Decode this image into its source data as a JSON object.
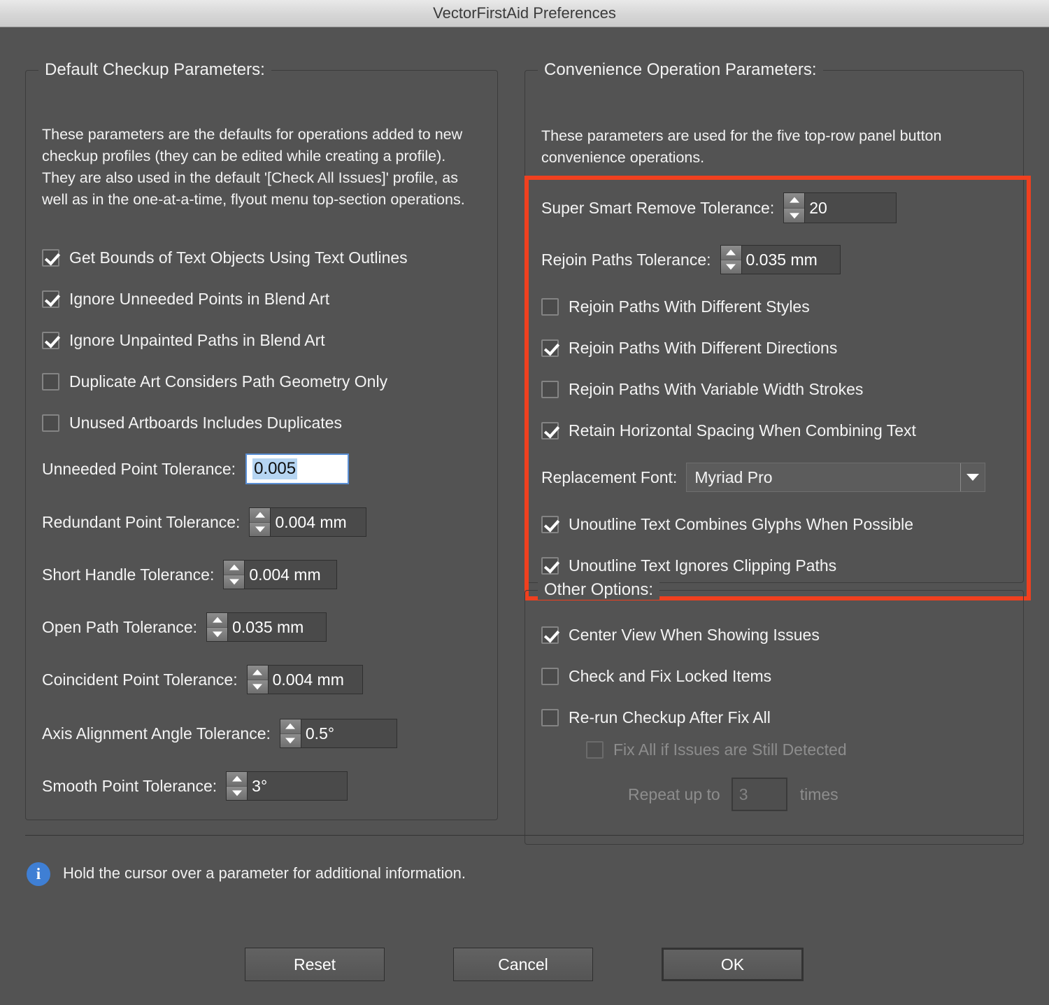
{
  "window": {
    "title": "VectorFirstAid Preferences"
  },
  "default_checkup": {
    "legend": "Default Checkup Parameters:",
    "description": "These parameters are the defaults for operations added to new checkup profiles (they can be edited while creating a profile). They are also used in the default '[Check All Issues]' profile, as well as in the one-at-a-time, flyout menu top-section operations.",
    "checkboxes": [
      {
        "label": "Get Bounds of Text Objects Using Text Outlines",
        "checked": true
      },
      {
        "label": "Ignore Unneeded Points in Blend Art",
        "checked": true
      },
      {
        "label": "Ignore Unpainted Paths in Blend Art",
        "checked": true
      },
      {
        "label": "Duplicate Art Considers Path Geometry Only",
        "checked": false
      },
      {
        "label": "Unused Artboards Includes Duplicates",
        "checked": false
      }
    ],
    "unneeded_point": {
      "label": "Unneeded Point Tolerance:",
      "value": "0.005",
      "selected": true
    },
    "fields": [
      {
        "label": "Redundant Point Tolerance:",
        "value": "0.004 mm"
      },
      {
        "label": "Short Handle Tolerance:",
        "value": "0.004 mm"
      },
      {
        "label": "Open Path Tolerance:",
        "value": "0.035 mm"
      },
      {
        "label": "Coincident Point Tolerance:",
        "value": "0.004 mm"
      },
      {
        "label": "Axis Alignment Angle Tolerance:",
        "value": "0.5°"
      },
      {
        "label": "Smooth Point Tolerance:",
        "value": "3°"
      }
    ]
  },
  "convenience": {
    "legend": "Convenience Operation Parameters:",
    "description": "These parameters are used for the five top-row panel button convenience operations.",
    "highlight_color": "#f0401f",
    "super_smart_remove": {
      "label": "Super Smart Remove Tolerance:",
      "value": "20"
    },
    "rejoin_paths_tolerance": {
      "label": "Rejoin Paths Tolerance:",
      "value": "0.035 mm"
    },
    "checkboxes": [
      {
        "label": "Rejoin Paths With Different Styles",
        "checked": false
      },
      {
        "label": "Rejoin Paths With Different Directions",
        "checked": true
      },
      {
        "label": "Rejoin Paths With Variable Width Strokes",
        "checked": false
      },
      {
        "label": "Retain Horizontal Spacing When Combining Text",
        "checked": true
      }
    ],
    "replacement_font": {
      "label": "Replacement Font:",
      "value": "Myriad Pro"
    },
    "checkboxes_after": [
      {
        "label": "Unoutline Text Combines Glyphs When Possible",
        "checked": true
      },
      {
        "label": "Unoutline Text Ignores Clipping Paths",
        "checked": true
      }
    ]
  },
  "other_options": {
    "legend": "Other Options:",
    "checkboxes": [
      {
        "label": "Center View When Showing Issues",
        "checked": true,
        "disabled": false
      },
      {
        "label": "Check and Fix Locked Items",
        "checked": false,
        "disabled": false
      },
      {
        "label": "Re-run Checkup After Fix All",
        "checked": false,
        "disabled": false
      },
      {
        "label": "Fix All if Issues are Still Detected",
        "checked": false,
        "disabled": true
      }
    ],
    "repeat": {
      "prefix": "Repeat up to",
      "value": "3",
      "suffix": "times"
    }
  },
  "footer": {
    "info_glyph": "i",
    "hint": "Hold the cursor over a parameter for additional information.",
    "buttons": {
      "reset": "Reset",
      "cancel": "Cancel",
      "ok": "OK"
    }
  }
}
